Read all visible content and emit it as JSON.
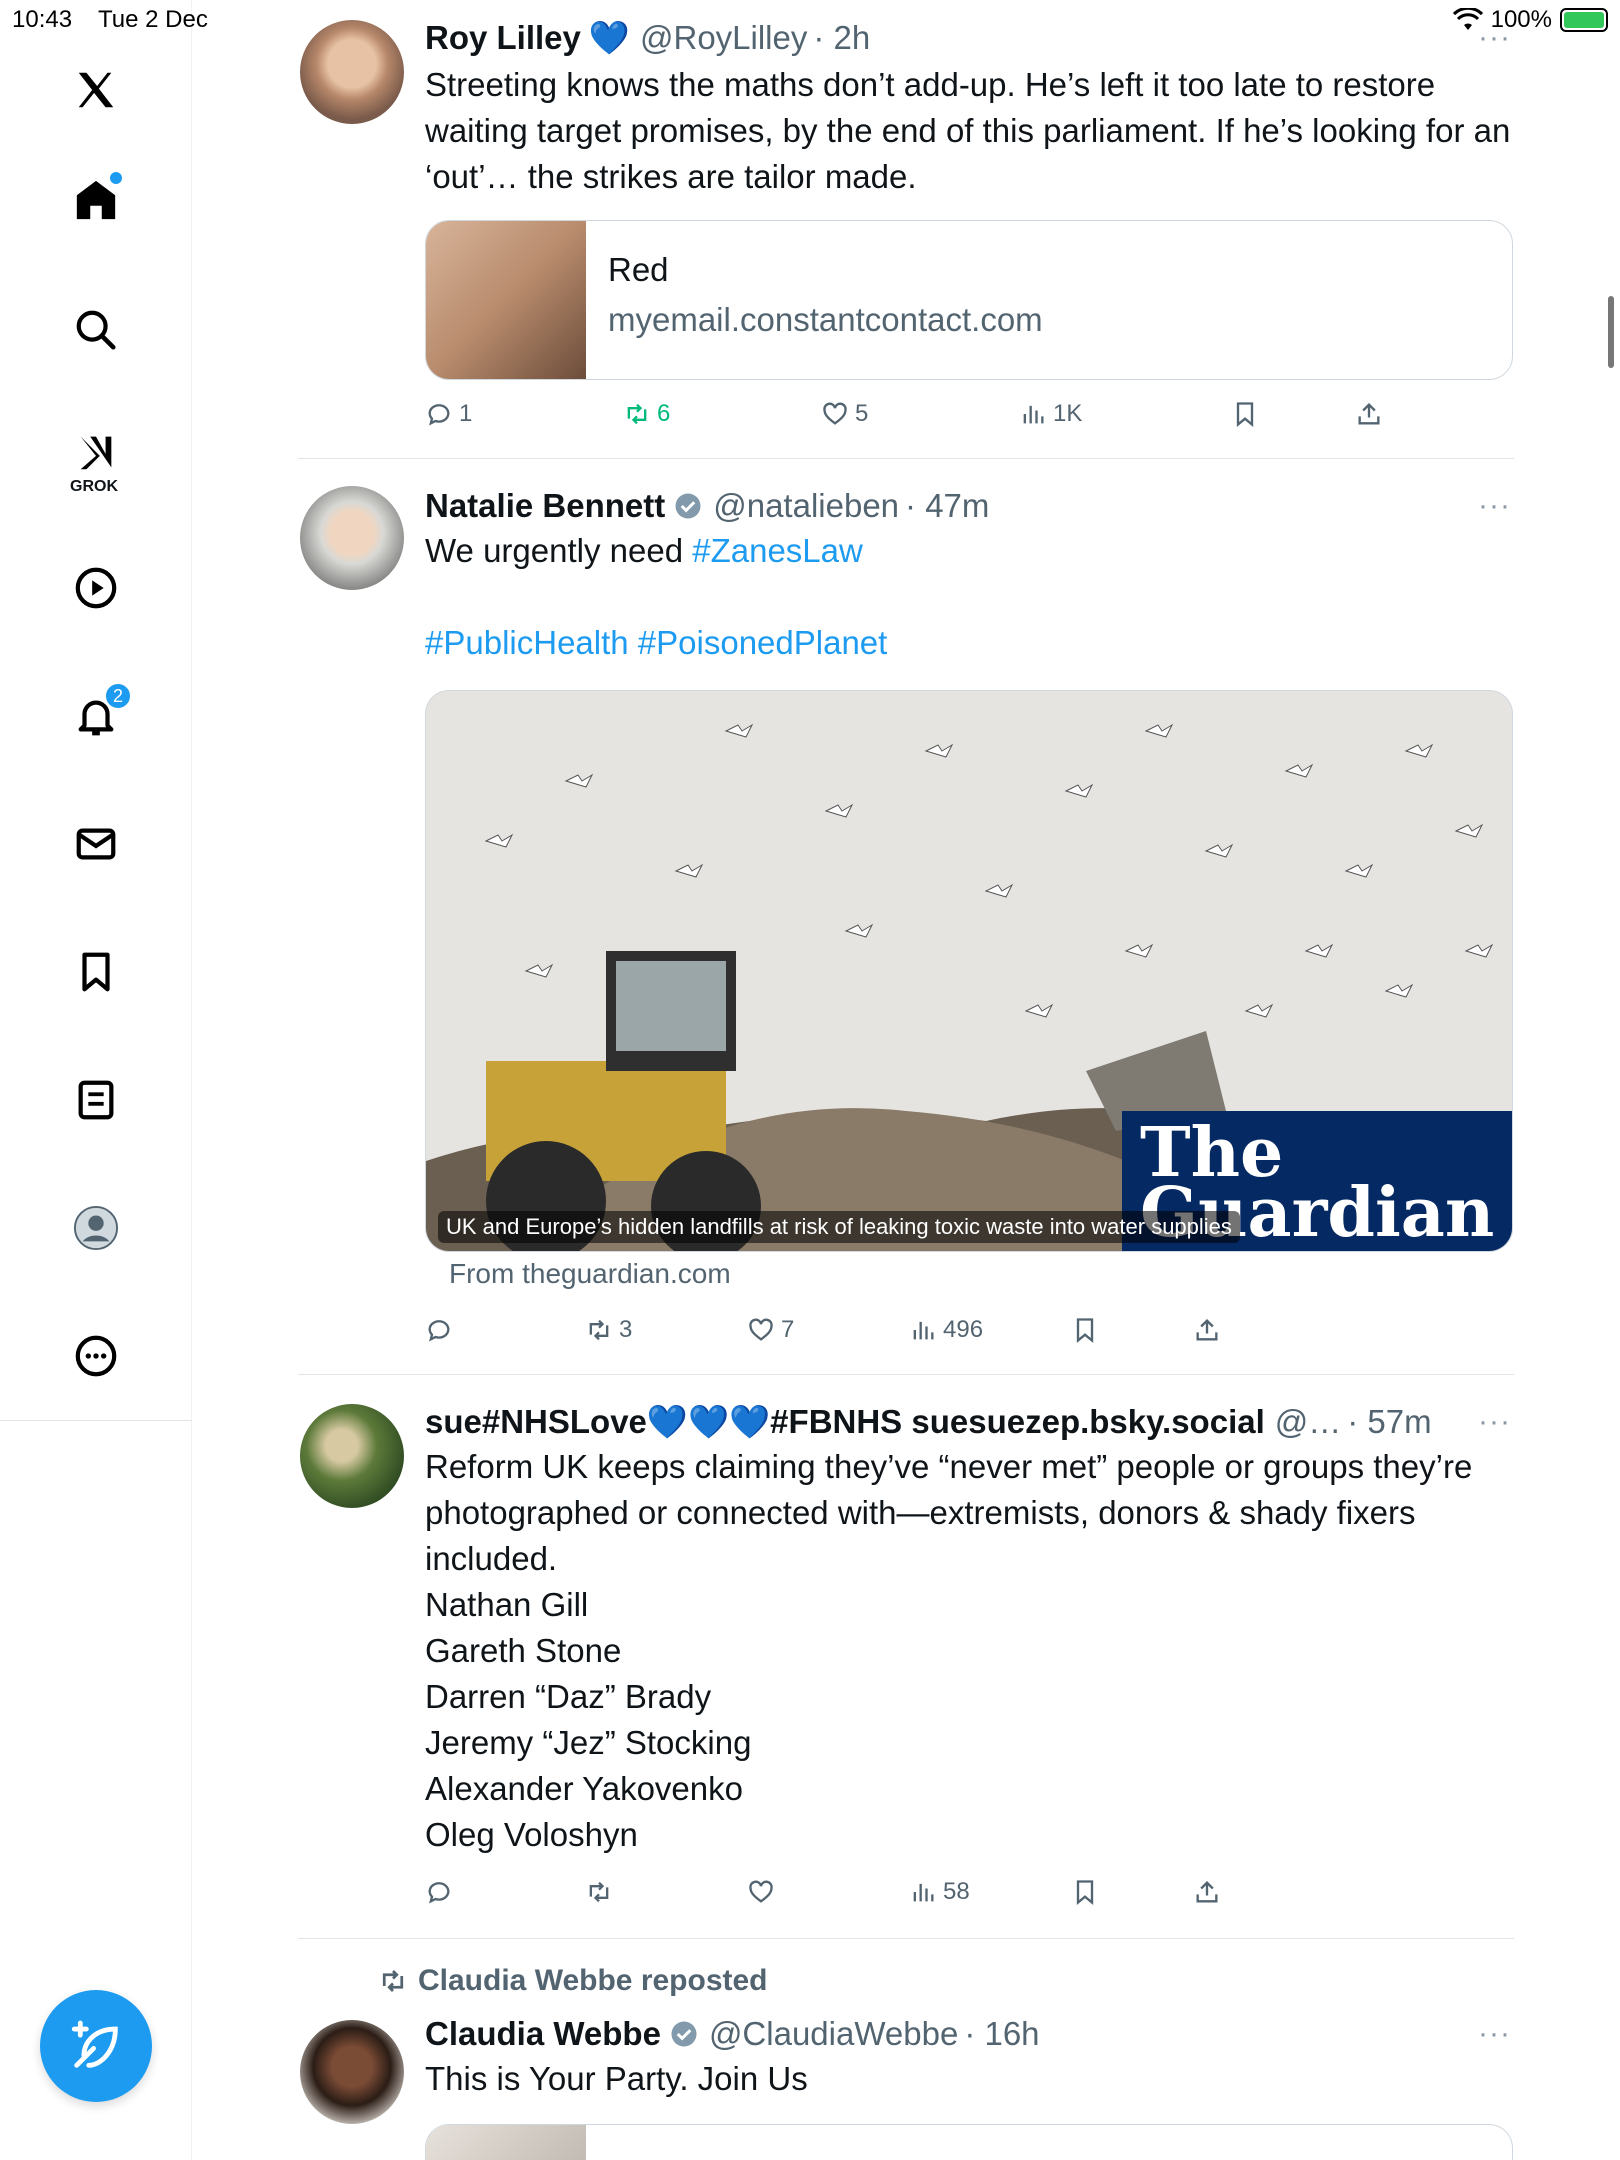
{
  "status_bar": {
    "time": "10:43",
    "date": "Tue 2 Dec",
    "battery": "100%"
  },
  "sidebar": {
    "items": [
      {
        "name": "home",
        "icon": "home-icon"
      },
      {
        "name": "explore",
        "icon": "search-icon"
      },
      {
        "name": "grok",
        "icon": "grok-icon",
        "label": "GROK"
      },
      {
        "name": "video",
        "icon": "play-icon"
      },
      {
        "name": "notifications",
        "icon": "bell-icon",
        "badge": "2"
      },
      {
        "name": "messages",
        "icon": "mail-icon"
      },
      {
        "name": "bookmarks",
        "icon": "bookmark-icon"
      },
      {
        "name": "lists",
        "icon": "list-icon"
      },
      {
        "name": "profile",
        "icon": "profile-icon"
      },
      {
        "name": "more",
        "icon": "more-icon"
      }
    ],
    "accent": "#1d9bf0"
  },
  "tweets": [
    {
      "name": "Roy Lilley",
      "emoji": "💙",
      "handle": "@RoyLilley",
      "time": "· 2h",
      "text": "Streeting knows the maths don’t add-up. He’s left it too late to restore waiting target promises, by the end of this parliament. If he’s looking for an ‘out’… the strikes are tailor made.",
      "card": {
        "title": "Red",
        "domain": "myemail.constantcontact.com"
      },
      "replies": "1",
      "reposts": "6",
      "likes": "5",
      "views": "1K"
    },
    {
      "name": "Natalie Bennett",
      "handle": "@natalieben",
      "time": "· 47m",
      "text_a": "We urgently need ",
      "hashtag_a": "#ZanesLaw",
      "hashtags_b": "#PublicHealth #PoisonedPlanet",
      "media_caption": "UK and Europe’s hidden landfills at risk of leaking toxic waste into water supplies",
      "media_brand": "The Guardian",
      "from": "From theguardian.com",
      "replies": "",
      "reposts": "3",
      "likes": "7",
      "views": "496"
    },
    {
      "name": "sue#NHSLove💙💙💙#FBNHS suesuezep.bsky.social",
      "handle": "@…",
      "time": "· 57m",
      "text": "Reform UK keeps claiming they’ve “never met” people or groups they’re photographed or connected with—extremists, donors & shady fixers included.",
      "list": [
        "Nathan Gill",
        "Gareth Stone",
        "Darren “Daz” Brady",
        "Jeremy “Jez” Stocking",
        "Alexander Yakovenko",
        "Oleg Voloshyn"
      ],
      "views": "58"
    },
    {
      "repost_by": "Claudia Webbe reposted",
      "name": "Claudia Webbe",
      "handle": "@ClaudiaWebbe",
      "time": "· 16h",
      "text": "This is Your Party. Join Us"
    }
  ],
  "more_glyph": "···"
}
